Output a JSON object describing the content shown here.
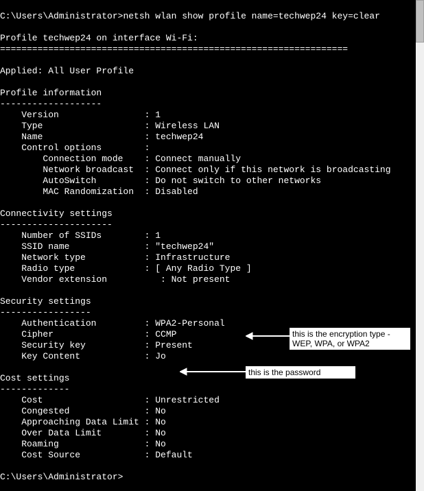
{
  "prompt_path": "C:\\Users\\Administrator>",
  "command": "netsh wlan show profile name=techwep24 key=clear",
  "header_profile_line": "Profile techwep24 on interface Wi-Fi:",
  "header_sep": "=================================================================",
  "applied_line": "Applied: All User Profile",
  "sections": {
    "profile_info": {
      "title": "Profile information",
      "dash": "-------------------",
      "rows": {
        "version": {
          "label": "    Version                : ",
          "value": "1"
        },
        "type": {
          "label": "    Type                   : ",
          "value": "Wireless LAN"
        },
        "name": {
          "label": "    Name                   : ",
          "value": "techwep24"
        },
        "ctl_opt": {
          "label": "    Control options        :",
          "value": ""
        },
        "conn_mode": {
          "label": "        Connection mode    : ",
          "value": "Connect manually"
        },
        "net_bcast": {
          "label": "        Network broadcast  : ",
          "value": "Connect only if this network is broadcasting"
        },
        "autosw": {
          "label": "        AutoSwitch         : ",
          "value": "Do not switch to other networks"
        },
        "mac_rand": {
          "label": "        MAC Randomization  : ",
          "value": "Disabled"
        }
      }
    },
    "connectivity": {
      "title": "Connectivity settings",
      "dash": "---------------------",
      "rows": {
        "num_ssids": {
          "label": "    Number of SSIDs        : ",
          "value": "1"
        },
        "ssid_name": {
          "label": "    SSID name              : ",
          "value": "\"techwep24\""
        },
        "net_type": {
          "label": "    Network type           : ",
          "value": "Infrastructure"
        },
        "radio": {
          "label": "    Radio type             : ",
          "value": "[ Any Radio Type ]"
        },
        "vendor": {
          "label": "    Vendor extension          : ",
          "value": "Not present"
        }
      }
    },
    "security": {
      "title": "Security settings",
      "dash": "-----------------",
      "rows": {
        "auth": {
          "label": "    Authentication         : ",
          "value": "WPA2-Personal"
        },
        "cipher": {
          "label": "    Cipher                 : ",
          "value": "CCMP"
        },
        "seckey": {
          "label": "    Security key           : ",
          "value": "Present"
        },
        "keycnt": {
          "label": "    Key Content            : ",
          "value": "Jo"
        }
      }
    },
    "cost": {
      "title": "Cost settings",
      "dash": "-------------",
      "rows": {
        "cost": {
          "label": "    Cost                   : ",
          "value": "Unrestricted"
        },
        "congested": {
          "label": "    Congested              : ",
          "value": "No"
        },
        "appr": {
          "label": "    Approaching Data Limit : ",
          "value": "No"
        },
        "over": {
          "label": "    Over Data Limit        : ",
          "value": "No"
        },
        "roaming": {
          "label": "    Roaming                : ",
          "value": "No"
        },
        "source": {
          "label": "    Cost Source            : ",
          "value": "Default"
        }
      }
    }
  },
  "final_prompt": "C:\\Users\\Administrator>",
  "annotations": {
    "enc_type": "this is the encryption type - WEP, WPA, or WPA2",
    "password": "this is the password"
  }
}
